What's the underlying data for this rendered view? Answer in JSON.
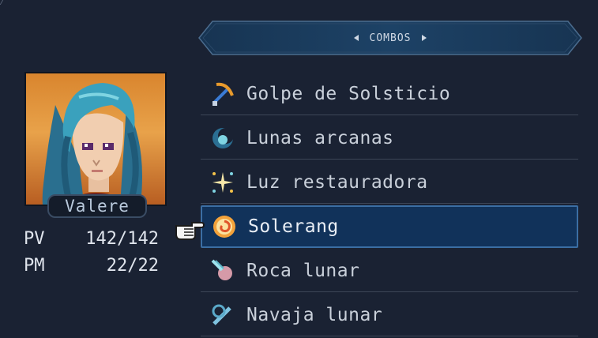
{
  "header": {
    "title": "COMBOS"
  },
  "character": {
    "name": "Valere",
    "stats": [
      {
        "label": "PV",
        "value": "142/142"
      },
      {
        "label": "PM",
        "value": "22/22"
      }
    ]
  },
  "skills": [
    {
      "label": "Golpe de Solsticio",
      "icon": "sword-icon"
    },
    {
      "label": "Lunas arcanas",
      "icon": "moon-shield-icon"
    },
    {
      "label": "Luz restauradora",
      "icon": "sparkle-icon"
    },
    {
      "label": "Solerang",
      "icon": "sun-swirl-icon"
    },
    {
      "label": "Roca lunar",
      "icon": "moon-rock-icon"
    },
    {
      "label": "Navaja lunar",
      "icon": "moon-blade-icon"
    }
  ],
  "selected_skill": "Solerang",
  "colors": {
    "background": "#1a2233",
    "selection": "#11325a",
    "selection_border": "#3b6ea3"
  }
}
